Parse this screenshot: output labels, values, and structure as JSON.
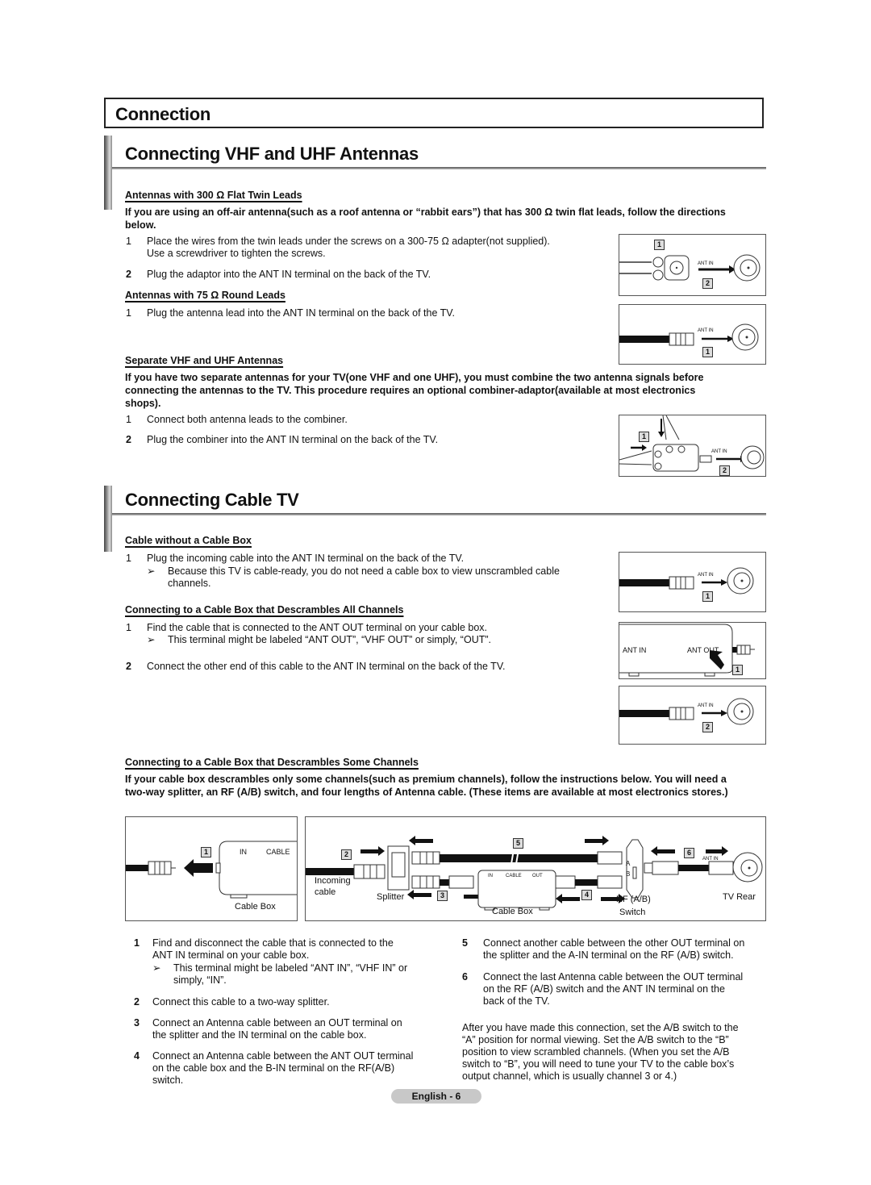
{
  "chapter_title": "Connection",
  "section1": {
    "title": "Connecting VHF and UHF Antennas",
    "sub1": {
      "heading": "Antennas with 300 Ω Flat Twin Leads",
      "intro": "If you are using an off-air antenna(such as a roof antenna or “rabbit ears”) that has 300 Ω twin flat leads, follow the directions below.",
      "intro_line1": "If you are using an off-air antenna(such as a roof antenna or “rabbit ears”) that has 300 Ω twin flat leads, follow the directions",
      "intro_line2": "below.",
      "steps": [
        {
          "num": "1",
          "line1": "Place the wires from the twin leads under the screws on a 300-75 Ω adapter(not supplied).",
          "line2": "Use a screwdriver to tighten the screws."
        },
        {
          "num": "2",
          "line1": "Plug the adaptor into the ANT IN terminal on the back of the TV."
        }
      ],
      "figure": {
        "tag1": "1",
        "tag2": "2",
        "label": "ANT IN"
      }
    },
    "sub2": {
      "heading": "Antennas with 75 Ω Round Leads",
      "steps": [
        {
          "num": "1",
          "line1": "Plug the antenna lead into the ANT IN terminal on the back of the TV."
        }
      ],
      "figure": {
        "tag1": "1",
        "label": "ANT IN"
      }
    },
    "sub3": {
      "heading": "Separate VHF and UHF Antennas",
      "intro_line1": "If you have two separate antennas for your TV(one VHF and one UHF), you must combine the two antenna signals before",
      "intro_line2": "connecting the antennas to the TV. This procedure requires an optional combiner-adaptor(available at most electronics",
      "intro_line3": "shops).",
      "steps": [
        {
          "num": "1",
          "line1": "Connect both antenna leads to the combiner."
        },
        {
          "num": "2",
          "line1": "Plug the combiner into the ANT IN terminal on the back of the TV."
        }
      ],
      "figure": {
        "tag1": "1",
        "tag2": "2",
        "label": "ANT IN"
      }
    }
  },
  "section2": {
    "title": "Connecting Cable TV",
    "sub1": {
      "heading": "Cable without a Cable Box",
      "steps": [
        {
          "num": "1",
          "line1": "Plug the incoming cable into the ANT IN terminal on the back of the TV."
        }
      ],
      "note_line1": "Because this TV is cable-ready, you do not need a cable box to view unscrambled cable",
      "note_line2": "channels.",
      "figure": {
        "tag1": "1",
        "label": "ANT IN"
      }
    },
    "sub2": {
      "heading": "Connecting to a Cable Box that Descrambles All Channels",
      "steps": [
        {
          "num": "1",
          "line1": "Find the cable that is connected to the ANT OUT terminal on your cable box."
        },
        {
          "num": "2",
          "line1": "Connect the other end of this cable to the ANT IN terminal on the back of the TV."
        }
      ],
      "note_line1": "This terminal might be labeled “ANT OUT”, “VHF OUT” or simply, “OUT”.",
      "figure_a": {
        "ant_in": "ANT IN",
        "ant_out": "ANT OUT",
        "tag1": "1"
      },
      "figure_b": {
        "tag2": "2",
        "label": "ANT IN"
      }
    },
    "sub3": {
      "heading": "Connecting to a Cable Box that Descrambles Some Channels",
      "intro_line1": "If your cable box descrambles only some channels(such as premium channels), follow the instructions below. You will need a",
      "intro_line2": "two-way splitter, an RF (A/B) switch, and four lengths of Antenna cable. (These items are available at most electronics stores.)",
      "figure_left": {
        "tag": "1",
        "in": "IN",
        "cable": "CABLE",
        "caption": "Cable Box"
      },
      "figure_right": {
        "tags": [
          "2",
          "3",
          "4",
          "5",
          "6"
        ],
        "incoming1": "Incoming",
        "incoming2": "cable",
        "splitter": "Splitter",
        "box_in": "IN",
        "box_cable": "CABLE",
        "box_out": "OUT",
        "box_caption": "Cable Box",
        "switch_a": "A",
        "switch_b": "B",
        "rf1": "RF (A/B)",
        "rf2": "Switch",
        "ant_in": "ANT IN",
        "tv_rear": "TV Rear"
      },
      "left_steps": [
        {
          "num": "1",
          "line1": "Find and disconnect the cable that is connected to the",
          "line2": "ANT IN terminal on your cable box."
        },
        {
          "num": "2",
          "line1": "Connect this cable to a two-way splitter."
        },
        {
          "num": "3",
          "line1": "Connect an Antenna cable between an OUT terminal on",
          "line2": "the splitter and the IN terminal on the cable box."
        },
        {
          "num": "4",
          "line1": "Connect an Antenna cable between the ANT OUT terminal",
          "line2": "on the cable box and the B-IN terminal on the RF(A/B)",
          "line3": "switch."
        }
      ],
      "left_note_line1": "This terminal might be labeled “ANT IN”, “VHF IN” or",
      "left_note_line2": "simply, “IN”.",
      "right_steps": [
        {
          "num": "5",
          "line1": "Connect another cable between the other OUT terminal on",
          "line2": "the splitter and the A-IN terminal on the RF (A/B) switch."
        },
        {
          "num": "6",
          "line1": "Connect the last Antenna cable between the OUT terminal",
          "line2": "on the RF (A/B) switch and the ANT IN terminal on the",
          "line3": "back of the TV."
        }
      ],
      "after": [
        "After you have made this connection, set the A/B switch to the",
        "“A” position for normal viewing. Set the A/B switch to the “B”",
        "position to view scrambled channels. (When you set the A/B",
        "switch to “B”, you will need to tune your TV to the cable box’s",
        "output channel, which is usually channel 3 or 4.)"
      ]
    }
  },
  "note_glyph": "➢",
  "footer": {
    "page_label": "English - 6"
  }
}
